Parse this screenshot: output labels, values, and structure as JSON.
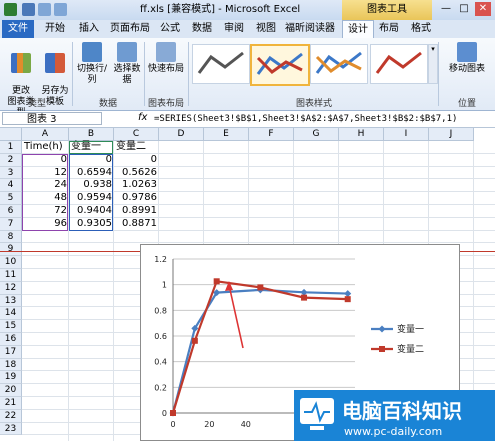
{
  "title": {
    "filename": "ff.xls",
    "mode": "[兼容模式]",
    "app": "Microsoft Excel",
    "context": "图表工具"
  },
  "tabs": [
    "文件",
    "开始",
    "插入",
    "页面布局",
    "公式",
    "数据",
    "审阅",
    "视图",
    "福昕阅读器",
    "设计",
    "布局",
    "格式"
  ],
  "ribbon": {
    "buttons": {
      "change_type": "更改\n图表类型",
      "save_template": "另存为\n模板",
      "switch_rowcol": "切换行/列",
      "select_data": "选择数据",
      "quick_layout": "快速布局",
      "move_chart": "移动图表"
    },
    "groups": {
      "type": "类型",
      "data": "数据",
      "layouts": "图表布局",
      "styles": "图表样式",
      "location": "位置"
    }
  },
  "formula_bar": {
    "name_box": "图表 3",
    "fx": "fx",
    "formula": "=SERIES(Sheet3!$B$1,Sheet3!$A$2:$A$7,Sheet3!$B$2:$B$7,1)"
  },
  "sheet": {
    "columns": [
      "A",
      "B",
      "C",
      "D",
      "E",
      "F",
      "G",
      "H",
      "I",
      "J"
    ],
    "rows": [
      "1",
      "2",
      "3",
      "4",
      "5",
      "6",
      "7",
      "8",
      "9",
      "10",
      "11",
      "12",
      "13",
      "14",
      "15",
      "16",
      "17",
      "18",
      "19",
      "20",
      "21",
      "22",
      "23"
    ],
    "table": {
      "headers": [
        "Time(h)",
        "变量一",
        "变量二"
      ],
      "values": [
        [
          "0",
          "0",
          "0"
        ],
        [
          "12",
          "0.6594",
          "0.5626"
        ],
        [
          "24",
          "0.938",
          "1.0263"
        ],
        [
          "48",
          "0.9594",
          "0.9786"
        ],
        [
          "72",
          "0.9404",
          "0.8991"
        ],
        [
          "96",
          "0.9305",
          "0.8871"
        ]
      ]
    }
  },
  "chart_data": {
    "type": "line",
    "x": [
      0,
      12,
      24,
      48,
      72,
      96
    ],
    "series": [
      {
        "name": "变量一",
        "values": [
          0,
          0.6594,
          0.938,
          0.9594,
          0.9404,
          0.9305
        ],
        "color": "#4a7fc1"
      },
      {
        "name": "变量二",
        "values": [
          0,
          0.5626,
          1.0263,
          0.9786,
          0.8991,
          0.8871
        ],
        "color": "#c0392b"
      }
    ],
    "yticks": [
      "0",
      "0.2",
      "0.4",
      "0.6",
      "0.8",
      "1",
      "1.2"
    ],
    "xticks": [
      "0",
      "20",
      "40"
    ],
    "ylim": [
      0,
      1.2
    ],
    "grid": true,
    "legend": "right"
  },
  "watermark": {
    "text": "电脑百科知识",
    "url": "www.pc-daily.com"
  }
}
